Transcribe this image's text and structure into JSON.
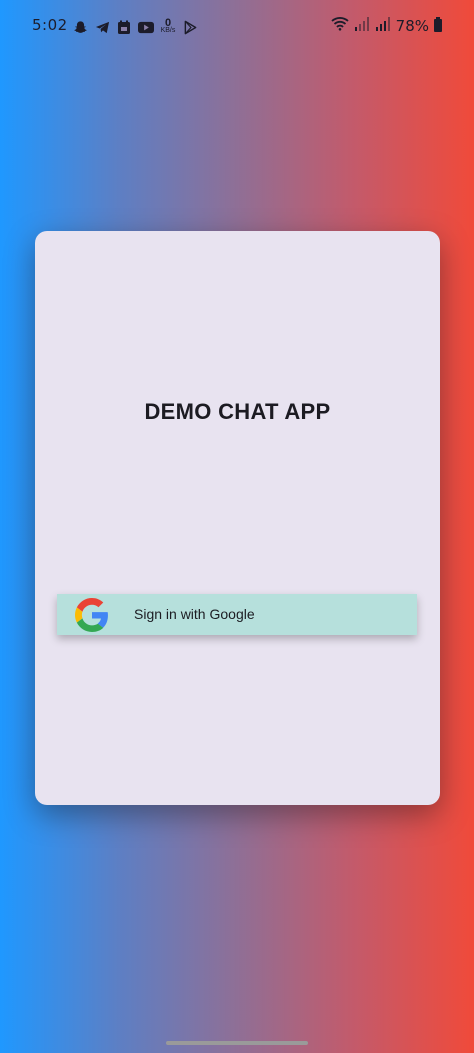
{
  "status_bar": {
    "time": "5:02",
    "netspeed_value": "0",
    "netspeed_unit": "KB/s",
    "battery_percent": "78%",
    "icons": [
      "snapchat-icon",
      "telegram-icon",
      "calendar-icon",
      "youtube-icon",
      "play-store-icon",
      "wifi-icon",
      "signal-icon",
      "battery-icon"
    ]
  },
  "card": {
    "title": "DEMO CHAT APP"
  },
  "google_button": {
    "label": "Sign in with Google"
  },
  "colors": {
    "gradient_left": "#1f98ff",
    "gradient_right": "#f04a3a",
    "card_bg": "#e8e3f0",
    "button_bg": "#b6e0dc"
  }
}
